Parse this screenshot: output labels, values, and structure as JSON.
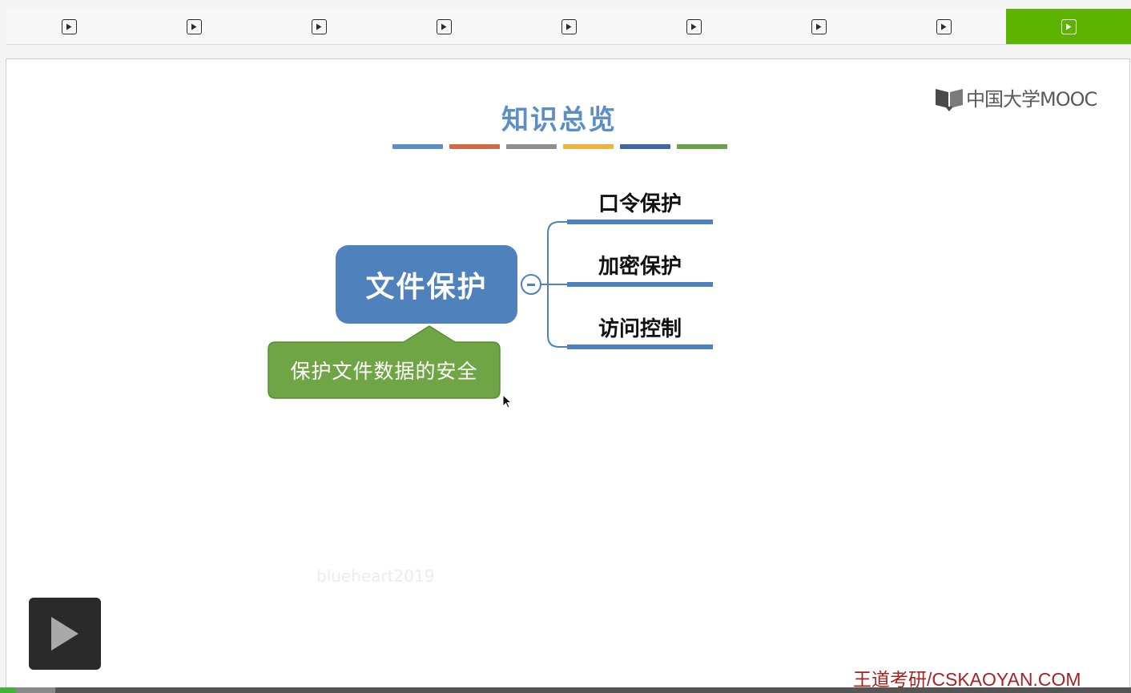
{
  "tabs": [
    {
      "icon": "play-icon",
      "active": false
    },
    {
      "icon": "play-icon",
      "active": false
    },
    {
      "icon": "play-icon",
      "active": false
    },
    {
      "icon": "play-icon",
      "active": false
    },
    {
      "icon": "play-icon",
      "active": false
    },
    {
      "icon": "play-icon",
      "active": false
    },
    {
      "icon": "play-icon",
      "active": false
    },
    {
      "icon": "play-icon",
      "active": false
    },
    {
      "icon": "play-icon",
      "active": true
    }
  ],
  "slide": {
    "logo_text": "中国大学MOOC",
    "title": "知识总览",
    "title_bar_colors": [
      "#5b8ec7",
      "#d06a48",
      "#8f8f8f",
      "#f0b23e",
      "#3f66a8",
      "#6aa04a"
    ],
    "mindmap": {
      "root": "文件保护",
      "branches": [
        "口令保护",
        "加密保护",
        "访问控制"
      ],
      "callout": "保护文件数据的安全"
    },
    "watermark": "blueheart2019",
    "site_credit": "王道考研/CSKAOYAN.COM"
  },
  "player": {
    "progress_fraction": 0.014,
    "buffer_fraction": 0.049
  },
  "colors": {
    "accent_green": "#5cb300",
    "node_blue": "#4f81bd",
    "callout_green": "#70a545",
    "credit_red": "#a72222"
  }
}
